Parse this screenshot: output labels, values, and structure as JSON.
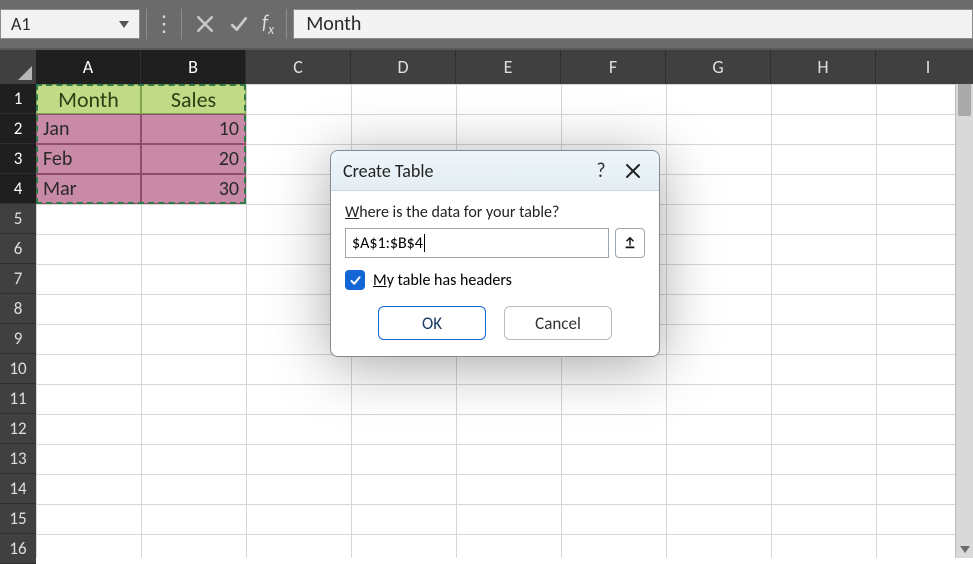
{
  "namebox": {
    "value": "A1"
  },
  "formula_bar": {
    "value": "Month"
  },
  "columns": [
    "A",
    "B",
    "C",
    "D",
    "E",
    "F",
    "G",
    "H",
    "I"
  ],
  "selected_columns": [
    "A",
    "B"
  ],
  "rows": [
    "1",
    "2",
    "3",
    "4",
    "5",
    "6",
    "7",
    "8",
    "9",
    "10",
    "11",
    "12",
    "13",
    "14",
    "15",
    "16"
  ],
  "selected_rows": [
    "1",
    "2",
    "3",
    "4"
  ],
  "table": {
    "headers": [
      "Month",
      "Sales"
    ],
    "rows": [
      {
        "month": "Jan",
        "sales": "10"
      },
      {
        "month": "Feb",
        "sales": "20"
      },
      {
        "month": "Mar",
        "sales": "30"
      }
    ]
  },
  "selection_range_text": "$A$1:$B$4",
  "dialog": {
    "title": "Create Table",
    "prompt_pre": "W",
    "prompt_rest": "here is the data for your table?",
    "range": "$A$1:$B$4",
    "checkbox_pre": "M",
    "checkbox_rest": "y table has headers",
    "checkbox_checked": true,
    "ok": "OK",
    "cancel": "Cancel"
  },
  "chart_data": {
    "type": "table",
    "title": "",
    "columns": [
      "Month",
      "Sales"
    ],
    "rows": [
      [
        "Jan",
        10
      ],
      [
        "Feb",
        20
      ],
      [
        "Mar",
        30
      ]
    ]
  }
}
